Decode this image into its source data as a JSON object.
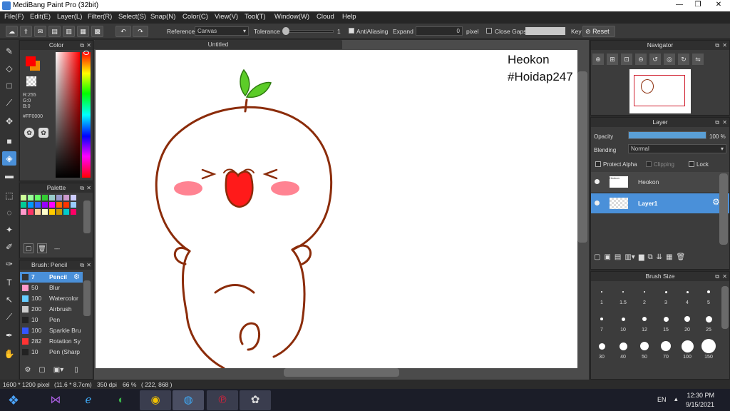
{
  "window": {
    "title": "MediBang Paint Pro (32bit)",
    "minimize": "—",
    "restore": "❐",
    "close": "✕"
  },
  "menu": [
    "File(F)",
    "Edit(E)",
    "Layer(L)",
    "Filter(R)",
    "Select(S)",
    "Snap(N)",
    "Color(C)",
    "View(V)",
    "Tool(T)",
    "Window(W)",
    "Cloud",
    "Help"
  ],
  "toolbar": {
    "reference_label": "Reference",
    "reference_value": "Canvas",
    "tolerance_label": "Tolerance",
    "tolerance_value": "1",
    "antialias_label": "AntiAliasing",
    "antialias_checked": true,
    "expand_label": "Expand",
    "expand_value": "0",
    "expand_unit": "pixel",
    "close_gaps_label": "Close Gaps",
    "key_label": "Key",
    "reset_label": "Reset"
  },
  "color_panel": {
    "title": "Color",
    "r": "R:255",
    "g": "G:0",
    "b": "B:0",
    "hex": "#FF0000",
    "primary_color": "#ff0000",
    "secondary_color": "#f08a00"
  },
  "palette_panel": {
    "title": "Palette",
    "footer": "---",
    "swatches": [
      "#ccff99",
      "#99ff99",
      "#66ff66",
      "#33cc33",
      "#99cccc",
      "#9999cc",
      "#cc99cc",
      "#ccccff",
      "#00cc99",
      "#0099ff",
      "#3366ff",
      "#9900ff",
      "#ff00ff",
      "#ff6600",
      "#ff3300",
      "#99ccff",
      "#ff99cc",
      "#ff3366",
      "#ffcc99",
      "#ffffcc",
      "#ffcc00",
      "#cc9900",
      "#00cccc",
      "#ff0066"
    ]
  },
  "brush_panel": {
    "title": "Brush: Pencil",
    "items": [
      {
        "size": "7",
        "name": "Pencil",
        "color": "#333333",
        "active": true
      },
      {
        "size": "50",
        "name": "Blur",
        "color": "#ff99cc",
        "active": false
      },
      {
        "size": "100",
        "name": "Watercolor",
        "color": "#66ccff",
        "active": false
      },
      {
        "size": "200",
        "name": "Airbrush",
        "color": "#cccccc",
        "active": false
      },
      {
        "size": "10",
        "name": "Pen",
        "color": "#222222",
        "active": false
      },
      {
        "size": "100",
        "name": "Sparkle Bru",
        "color": "#3355ff",
        "active": false
      },
      {
        "size": "282",
        "name": "Rotation Sy",
        "color": "#ff3333",
        "active": false
      },
      {
        "size": "10",
        "name": "Pen (Sharp",
        "color": "#222222",
        "active": false
      }
    ]
  },
  "canvas": {
    "tab_title": "Untitled",
    "text_line1": "Heokon",
    "text_line2": "#Hoidap247"
  },
  "navigator": {
    "title": "Navigator"
  },
  "layer_panel": {
    "title": "Layer",
    "opacity_label": "Opacity",
    "opacity_value": "100 %",
    "opacity_fraction": 1.0,
    "blending_label": "Blending",
    "blending_value": "Normal",
    "protect_alpha_label": "Protect Alpha",
    "clipping_label": "Clipping",
    "lock_label": "Lock",
    "layers": [
      {
        "name": "Heokon",
        "selected": false
      },
      {
        "name": "Layer1",
        "selected": true
      }
    ]
  },
  "brush_size_panel": {
    "title": "Brush Size",
    "sizes": [
      "1",
      "1.5",
      "2",
      "3",
      "4",
      "5",
      "7",
      "10",
      "12",
      "15",
      "20",
      "25",
      "30",
      "40",
      "50",
      "70",
      "100",
      "150"
    ]
  },
  "status": {
    "dimensions": "1600 * 1200 pixel",
    "physical": "(11.6 * 8.7cm)",
    "dpi": "350 dpi",
    "zoom": "66 %",
    "coords": "( 222, 868 )"
  },
  "taskbar": {
    "language": "EN",
    "time": "12:30 PM",
    "date": "9/15/2021"
  },
  "colors": {
    "accent": "#4a90d9",
    "drawing_line": "#8b2c0a",
    "leaf": "#5ccc28",
    "cheek": "#ff5a6e",
    "mouth": "#ff1a1a"
  }
}
